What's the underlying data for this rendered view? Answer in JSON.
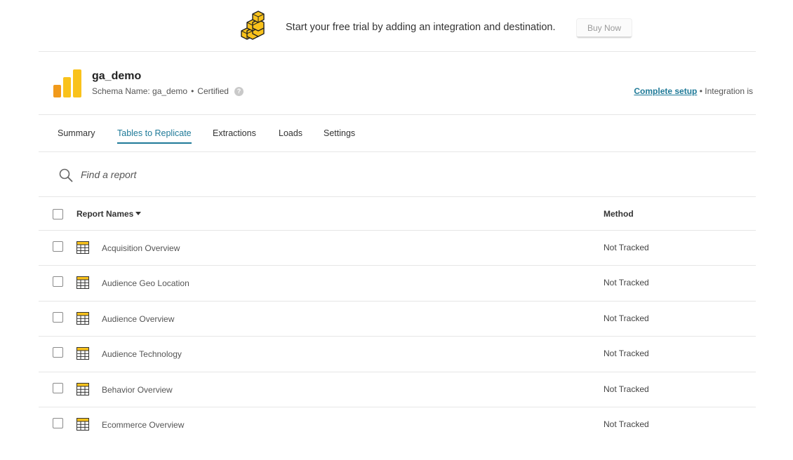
{
  "banner": {
    "logo_icon": "stacked-blocks-icon",
    "message": "Start your free trial by adding an integration and destination.",
    "buy_label": "Buy Now"
  },
  "integration": {
    "logo_icon": "google-analytics-icon",
    "title": "ga_demo",
    "schema_label": "Schema Name: ga_demo",
    "separator": "•",
    "certified_label": "Certified",
    "help_icon": "question-circle-icon",
    "help_text": "?",
    "setup_link": "Complete setup",
    "setup_status": "Integration is"
  },
  "tabs": [
    {
      "label": "Summary",
      "active": false
    },
    {
      "label": "Tables to Replicate",
      "active": true
    },
    {
      "label": "Extractions",
      "active": false
    },
    {
      "label": "Loads",
      "active": false
    },
    {
      "label": "Settings",
      "active": false
    }
  ],
  "search": {
    "icon": "search-icon",
    "placeholder": "Find a report"
  },
  "table": {
    "columns": {
      "name": "Report Names",
      "method": "Method"
    },
    "row_icon": "table-grid-icon",
    "rows": [
      {
        "name": "Acquisition Overview",
        "method": "Not Tracked"
      },
      {
        "name": "Audience Geo Location",
        "method": "Not Tracked"
      },
      {
        "name": "Audience Overview",
        "method": "Not Tracked"
      },
      {
        "name": "Audience Technology",
        "method": "Not Tracked"
      },
      {
        "name": "Behavior Overview",
        "method": "Not Tracked"
      },
      {
        "name": "Ecommerce Overview",
        "method": "Not Tracked"
      }
    ]
  },
  "colors": {
    "accent": "#1f7a98",
    "logo_yellow": "#f9c21b",
    "logo_orange": "#f19a1b"
  }
}
